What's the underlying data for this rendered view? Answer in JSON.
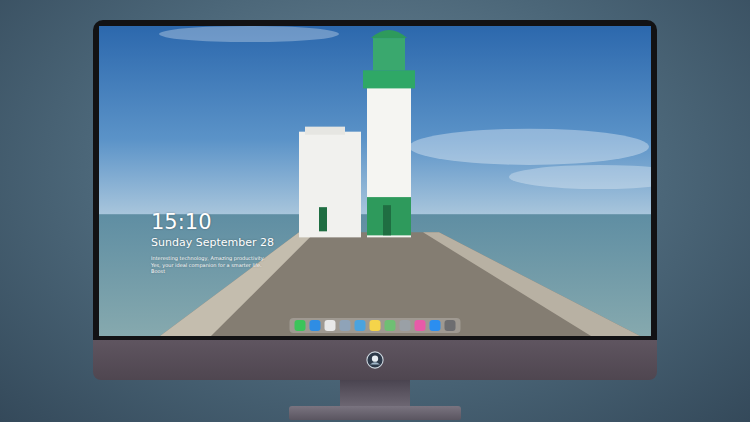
{
  "lock_screen": {
    "time": "15:10",
    "date": "Sunday September 28",
    "caption": "Interesting technology, Amazing productivity. Yes, your ideal companion for a smarter life. Boost"
  },
  "dock": {
    "items": [
      {
        "color": "#3cc45a"
      },
      {
        "color": "#2f8de4"
      },
      {
        "color": "#e8e8e8"
      },
      {
        "color": "#8fa3b8"
      },
      {
        "color": "#4aa3df"
      },
      {
        "color": "#f5d44a"
      },
      {
        "color": "#6fbf73"
      },
      {
        "color": "#9aa0a6"
      },
      {
        "color": "#e85aa8"
      },
      {
        "color": "#2b8ef0"
      },
      {
        "color": "#6d6d70"
      }
    ]
  }
}
